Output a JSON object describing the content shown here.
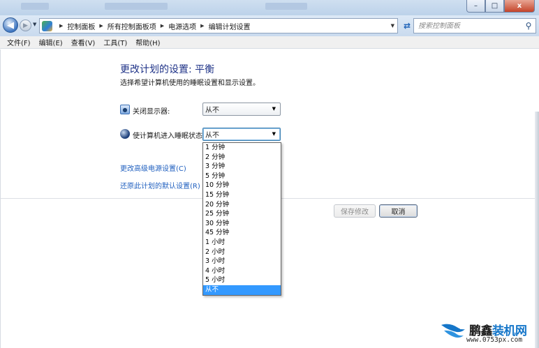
{
  "window": {
    "controls": {
      "minimize": "–",
      "maximize": "□",
      "close": "x"
    }
  },
  "navigation": {
    "back_icon": "back-arrow-icon",
    "forward_icon": "forward-arrow-icon",
    "breadcrumb": [
      "控制面板",
      "所有控制面板项",
      "电源选项",
      "编辑计划设置"
    ],
    "search_placeholder": "搜索控制面板"
  },
  "menu": [
    "文件(F)",
    "编辑(E)",
    "查看(V)",
    "工具(T)",
    "帮助(H)"
  ],
  "page": {
    "title": "更改计划的设置: 平衡",
    "subtitle": "选择希望计算机使用的睡眠设置和显示设置。"
  },
  "settings": {
    "display_off": {
      "label": "关闭显示器:",
      "value": "从不",
      "icon": "monitor-icon"
    },
    "sleep": {
      "label": "使计算机进入睡眠状态:",
      "value": "从不",
      "icon": "moon-icon"
    }
  },
  "dropdown": {
    "options": [
      "1 分钟",
      "2 分钟",
      "3 分钟",
      "5 分钟",
      "10 分钟",
      "15 分钟",
      "20 分钟",
      "25 分钟",
      "30 分钟",
      "45 分钟",
      "1 小时",
      "2 小时",
      "3 小时",
      "4 小时",
      "5 小时",
      "从不"
    ],
    "selected": "从不"
  },
  "links": {
    "advanced": "更改高级电源设置(C)",
    "restore": "还原此计划的默认设置(R)"
  },
  "buttons": {
    "save": "保存修改",
    "cancel": "取消"
  },
  "watermark": {
    "title_dark": "鹏鑫",
    "title_blue": "装机网",
    "url": "www.0753px.com"
  },
  "colors": {
    "title": "#1e3287",
    "link": "#1f5fbf",
    "selection": "#3399ff"
  }
}
